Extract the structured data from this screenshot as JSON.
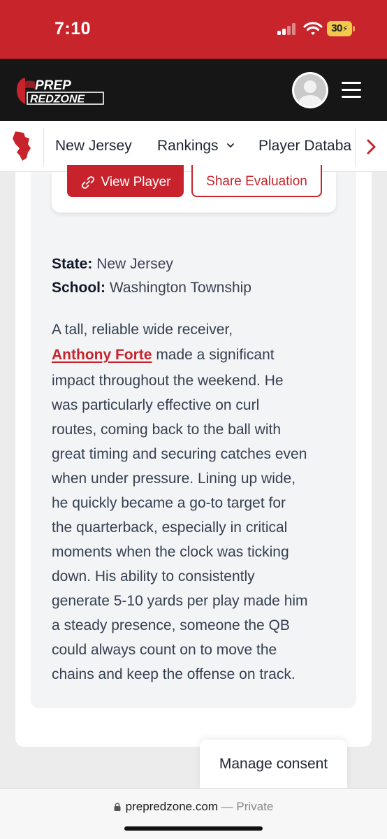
{
  "status_bar": {
    "time": "7:10",
    "battery": "30",
    "colors": {
      "background": "#c7252b"
    }
  },
  "header": {
    "logo_text_top": "PREP",
    "logo_text_bottom": "REDZONE",
    "avatar_icon": "user-avatar-icon",
    "menu_icon": "hamburger-menu-icon"
  },
  "nav": {
    "state_icon": "new-jersey-map-icon",
    "items": [
      {
        "label": "New Jersey"
      },
      {
        "label": "Rankings",
        "icon": "chevron-down-icon"
      },
      {
        "label": "Player Databa"
      }
    ],
    "next_icon": "chevron-right-icon"
  },
  "actions": {
    "view_player": "View Player",
    "view_player_icon": "link-icon",
    "share_evaluation": "Share Evaluation"
  },
  "meta": {
    "state_label": "State:",
    "state_value": "New Jersey",
    "school_label": "School:",
    "school_value": "Washington Township"
  },
  "bio": {
    "intro": "A tall, reliable wide receiver,",
    "player_name": "Anthony Forte",
    "line2_rest": " made a significant",
    "lines": [
      "impact throughout the weekend. He",
      "was particularly effective on curl",
      "routes, coming back to the ball with",
      "great timing and securing catches even",
      "when under pressure. Lining up wide,",
      "he quickly became a go-to target for",
      "the quarterback, especially in critical",
      "moments when the clock was ticking",
      "down. His ability to consistently",
      "generate 5-10 yards per play made him",
      "a steady presence, someone the QB",
      "could always count on to move the",
      "chains and keep the offense on track."
    ]
  },
  "consent": {
    "label": "Manage consent"
  },
  "browser": {
    "domain": "prepredzone.com",
    "separator": " — ",
    "mode": "Private"
  },
  "colors": {
    "brand_red": "#c8232c",
    "header_dark": "#161616"
  }
}
